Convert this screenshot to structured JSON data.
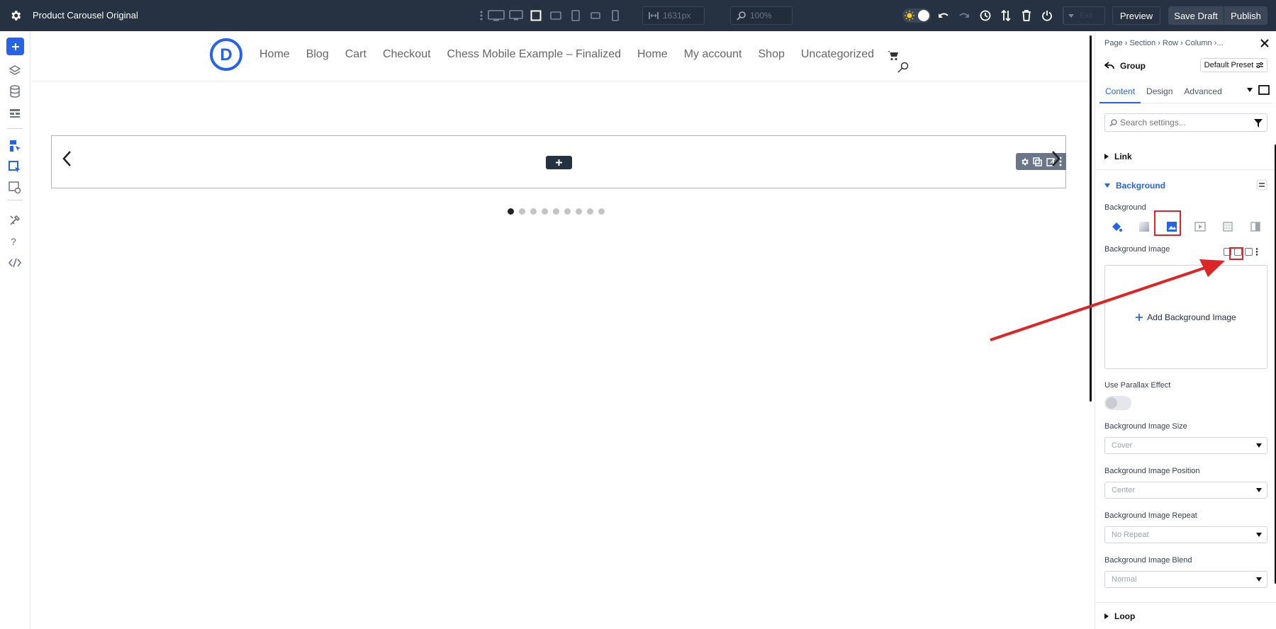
{
  "app": {
    "title": "Product Carousel Original",
    "width_value": "1631px",
    "zoom_value": "100%",
    "exit_label": "Exit",
    "preview_label": "Preview",
    "save_draft_label": "Save Draft",
    "publish_label": "Publish"
  },
  "site": {
    "logo_letter": "D",
    "nav": [
      "Home",
      "Blog",
      "Cart",
      "Checkout",
      "Chess Mobile Example – Finalized",
      "Home",
      "My account",
      "Shop",
      "Uncategorized"
    ],
    "carousel_dots": 9,
    "active_dot": 0
  },
  "panel": {
    "breadcrumb": "Page  ›  Section  ›  Row  ›  Column  ›...",
    "module_title": "Group",
    "preset_label": "Default Preset",
    "tabs": [
      "Content",
      "Design",
      "Advanced"
    ],
    "active_tab": "Content",
    "search_placeholder": "Search settings...",
    "link_section": "Link",
    "background_section": "Background",
    "background_label": "Background",
    "bg_image_label": "Background Image",
    "add_bg_image": "Add Background Image",
    "parallax_label": "Use Parallax Effect",
    "size_label": "Background Image Size",
    "size_value": "Cover",
    "position_label": "Background Image Position",
    "position_value": "Center",
    "repeat_label": "Background Image Repeat",
    "repeat_value": "No Repeat",
    "blend_label": "Background Image Blend",
    "blend_value": "Normal",
    "loop_section": "Loop"
  },
  "colors": {
    "toolbar_bg": "#263142",
    "accent": "#2563eb",
    "highlight": "#dc2626"
  }
}
